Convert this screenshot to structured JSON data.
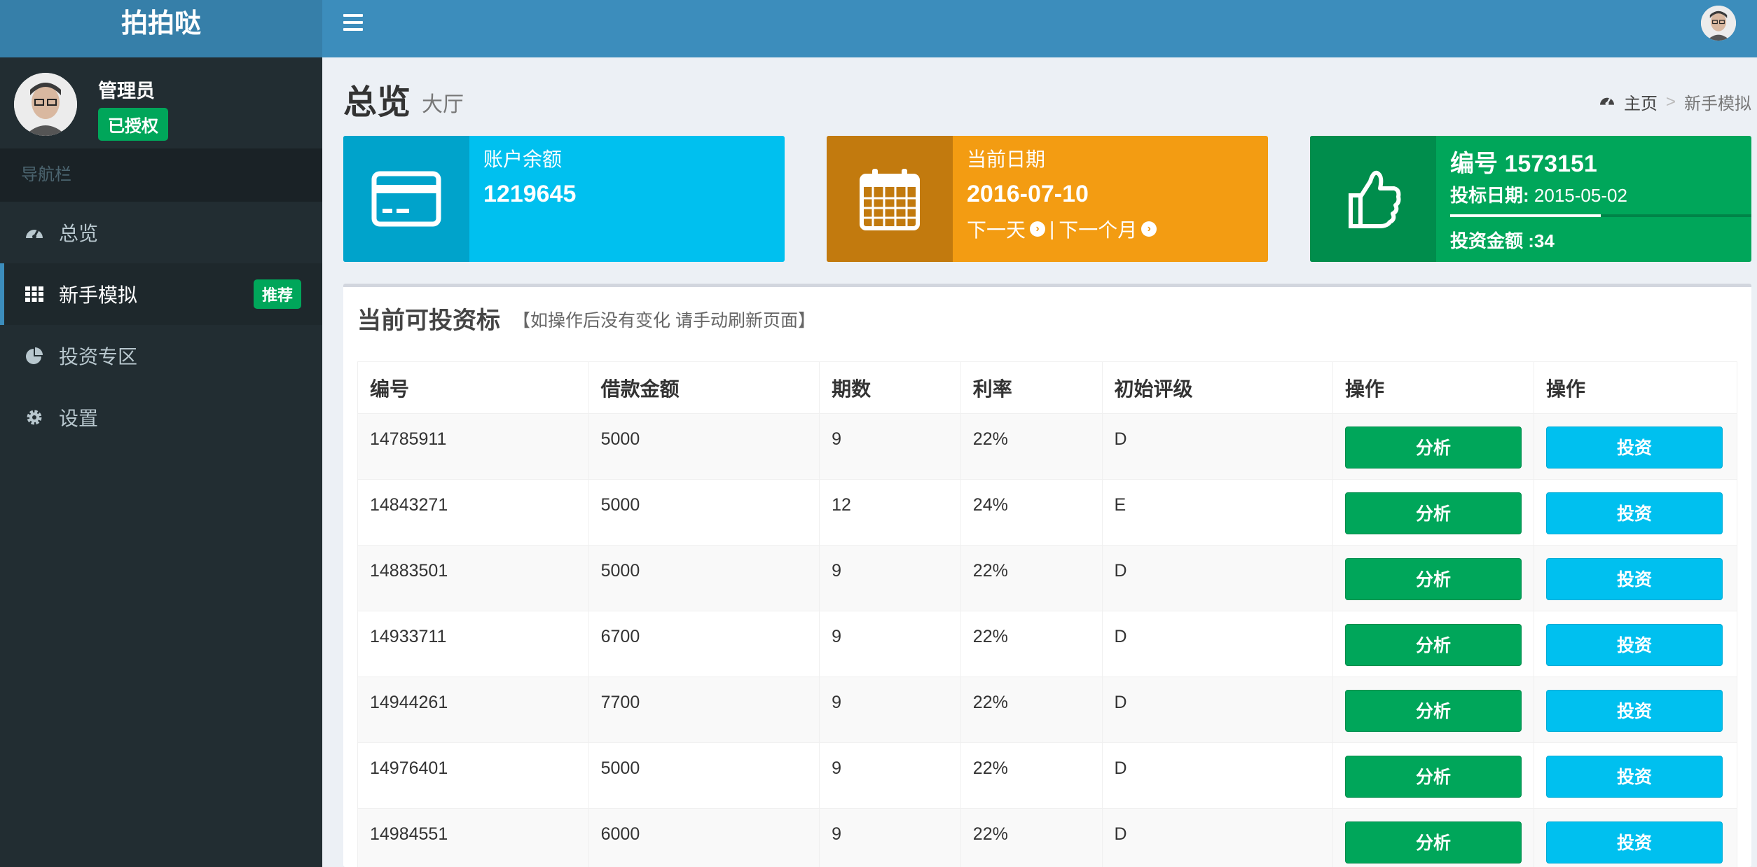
{
  "app": {
    "logo": "拍拍哒"
  },
  "user": {
    "name": "管理员",
    "badge": "已授权"
  },
  "sidebar": {
    "header": "导航栏",
    "items": [
      {
        "label": "总览",
        "icon": "dashboard-icon"
      },
      {
        "label": "新手模拟",
        "icon": "grid-icon",
        "badge": "推荐",
        "active": true
      },
      {
        "label": "投资专区",
        "icon": "pie-chart-icon"
      },
      {
        "label": "设置",
        "icon": "gear-icon"
      }
    ]
  },
  "page": {
    "title": "总览",
    "subtitle": "大厅"
  },
  "breadcrumb": {
    "home": "主页",
    "separator": ">",
    "current": "新手模拟"
  },
  "infoboxes": {
    "balance": {
      "label": "账户余额",
      "value": "1219645",
      "color": "#00c0ef",
      "icon_bg": "#00a3cb",
      "icon": "credit-card-icon"
    },
    "date": {
      "label": "当前日期",
      "value": "2016-07-10",
      "next_day": "下一天",
      "divider": "|",
      "next_month": "下一个月",
      "color": "#f39c12",
      "icon_bg": "#cf850f",
      "icon": "calendar-icon"
    },
    "loan": {
      "id_label": "编号 1573151",
      "date_label": "投标日期:",
      "date_value": "2015-05-02",
      "amount_label": "投资金额 :34",
      "progress": 0.5,
      "color": "#00a65a",
      "icon_bg": "#008d4c",
      "icon": "thumbs-up-icon"
    }
  },
  "box": {
    "title": "当前可投资标",
    "note": "【如操作后没有变化 请手动刷新页面】"
  },
  "table": {
    "headers": [
      "编号",
      "借款金额",
      "期数",
      "利率",
      "初始评级",
      "操作",
      "操作"
    ],
    "analyze_label": "分析",
    "invest_label": "投资",
    "rows": [
      [
        "14785911",
        "5000",
        "9",
        "22%",
        "D"
      ],
      [
        "14843271",
        "5000",
        "12",
        "24%",
        "E"
      ],
      [
        "14883501",
        "5000",
        "9",
        "22%",
        "D"
      ],
      [
        "14933711",
        "6700",
        "9",
        "22%",
        "D"
      ],
      [
        "14944261",
        "7700",
        "9",
        "22%",
        "D"
      ],
      [
        "14976401",
        "5000",
        "9",
        "22%",
        "D"
      ],
      [
        "14984551",
        "6000",
        "9",
        "22%",
        "D"
      ]
    ]
  }
}
